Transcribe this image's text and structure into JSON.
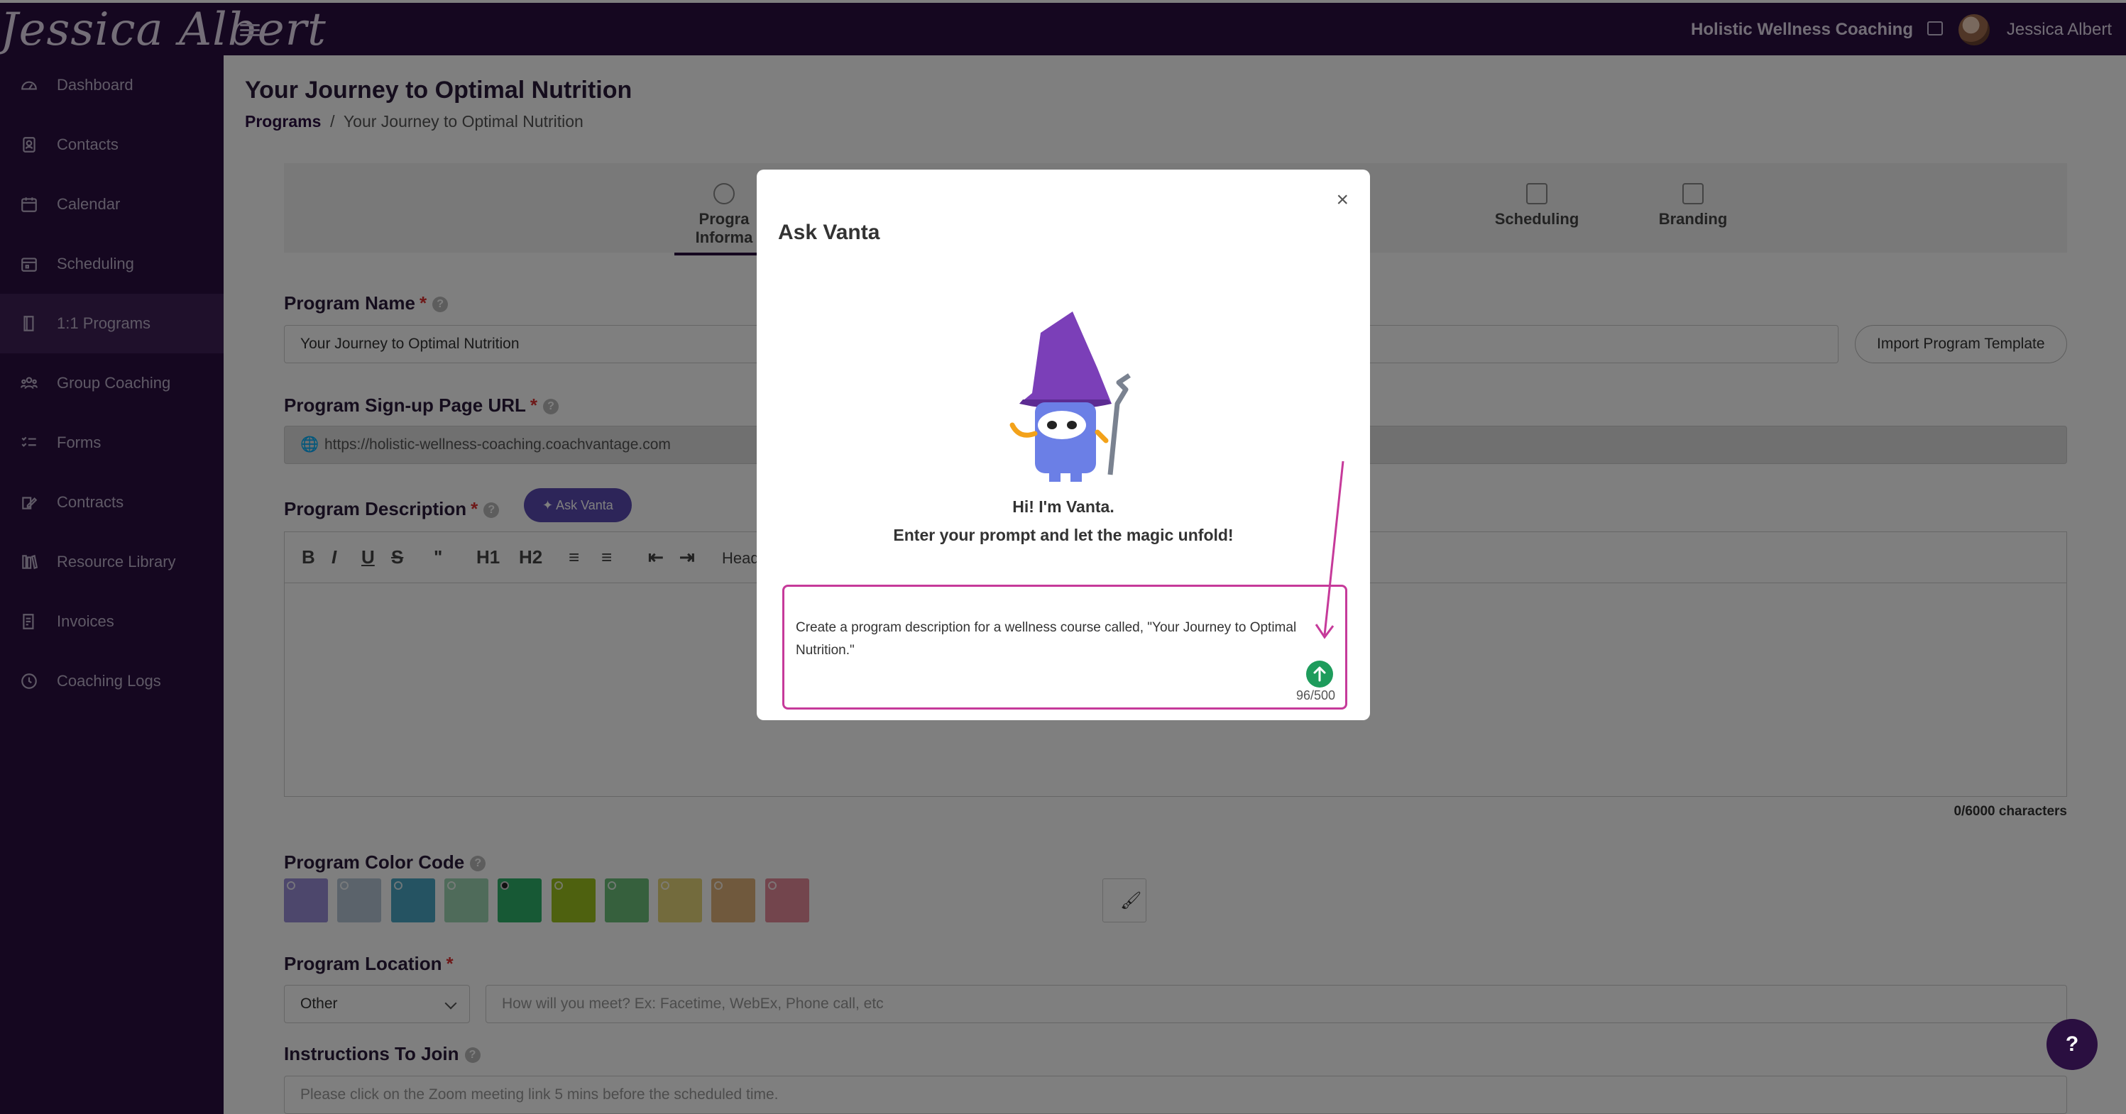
{
  "topbar": {
    "logo_text": "Jessica Albert",
    "company": "Holistic Wellness Coaching",
    "user_name": "Jessica Albert"
  },
  "sidebar": {
    "items": [
      {
        "label": "Dashboard",
        "icon": "dashboard-icon"
      },
      {
        "label": "Contacts",
        "icon": "contacts-icon"
      },
      {
        "label": "Calendar",
        "icon": "calendar-icon"
      },
      {
        "label": "Scheduling",
        "icon": "scheduling-icon"
      },
      {
        "label": "1:1 Programs",
        "icon": "programs-icon",
        "active": true
      },
      {
        "label": "Group Coaching",
        "icon": "group-icon"
      },
      {
        "label": "Forms",
        "icon": "forms-icon"
      },
      {
        "label": "Contracts",
        "icon": "contracts-icon"
      },
      {
        "label": "Resource Library",
        "icon": "library-icon"
      },
      {
        "label": "Invoices",
        "icon": "invoices-icon"
      },
      {
        "label": "Coaching Logs",
        "icon": "clock-icon"
      }
    ]
  },
  "page": {
    "title": "Your Journey to Optimal Nutrition",
    "breadcrumb_link": "Programs",
    "breadcrumb_sep": "/",
    "breadcrumb_current": "Your Journey to Optimal Nutrition"
  },
  "steps": {
    "first_line1": "Progra",
    "first_line2": "Informa",
    "scheduling": "Scheduling",
    "branding": "Branding"
  },
  "form": {
    "program_name_label": "Program Name",
    "program_name_value": "Your Journey to Optimal Nutrition",
    "import_button": "Import Program Template",
    "signup_url_label": "Program Sign-up Page URL",
    "signup_url_value": "https://holistic-wellness-coaching.coachvantage.com",
    "description_label": "Program Description",
    "ask_vanta_button": "Ask Vanta",
    "toolbar_heading": "Headi",
    "description_count": "0/6000 characters",
    "color_code_label": "Program Color Code",
    "location_label": "Program Location",
    "location_select": "Other",
    "location_placeholder": "How will you meet? Ex: Facetime, WebEx, Phone call, etc",
    "instructions_label": "Instructions To Join",
    "instructions_placeholder": "Please click on the Zoom meeting link 5 mins before the scheduled time.",
    "required_mark": "*"
  },
  "colors": {
    "swatches": [
      "#9a8ed8",
      "#b6c6d6",
      "#4aa6c4",
      "#9fd6b4",
      "#2fb36a",
      "#9cc31e",
      "#6cc07a",
      "#e6d67a",
      "#e0b27a",
      "#e68a9a"
    ]
  },
  "modal": {
    "title": "Ask Vanta",
    "close": "×",
    "greeting": "Hi! I'm Vanta.",
    "subtitle": "Enter your prompt and let the magic unfold!",
    "prompt_text": "Create a program description for a wellness course called, \"Your Journey to Optimal Nutrition.\"",
    "prompt_count": "96/500"
  },
  "help_fab": "?"
}
